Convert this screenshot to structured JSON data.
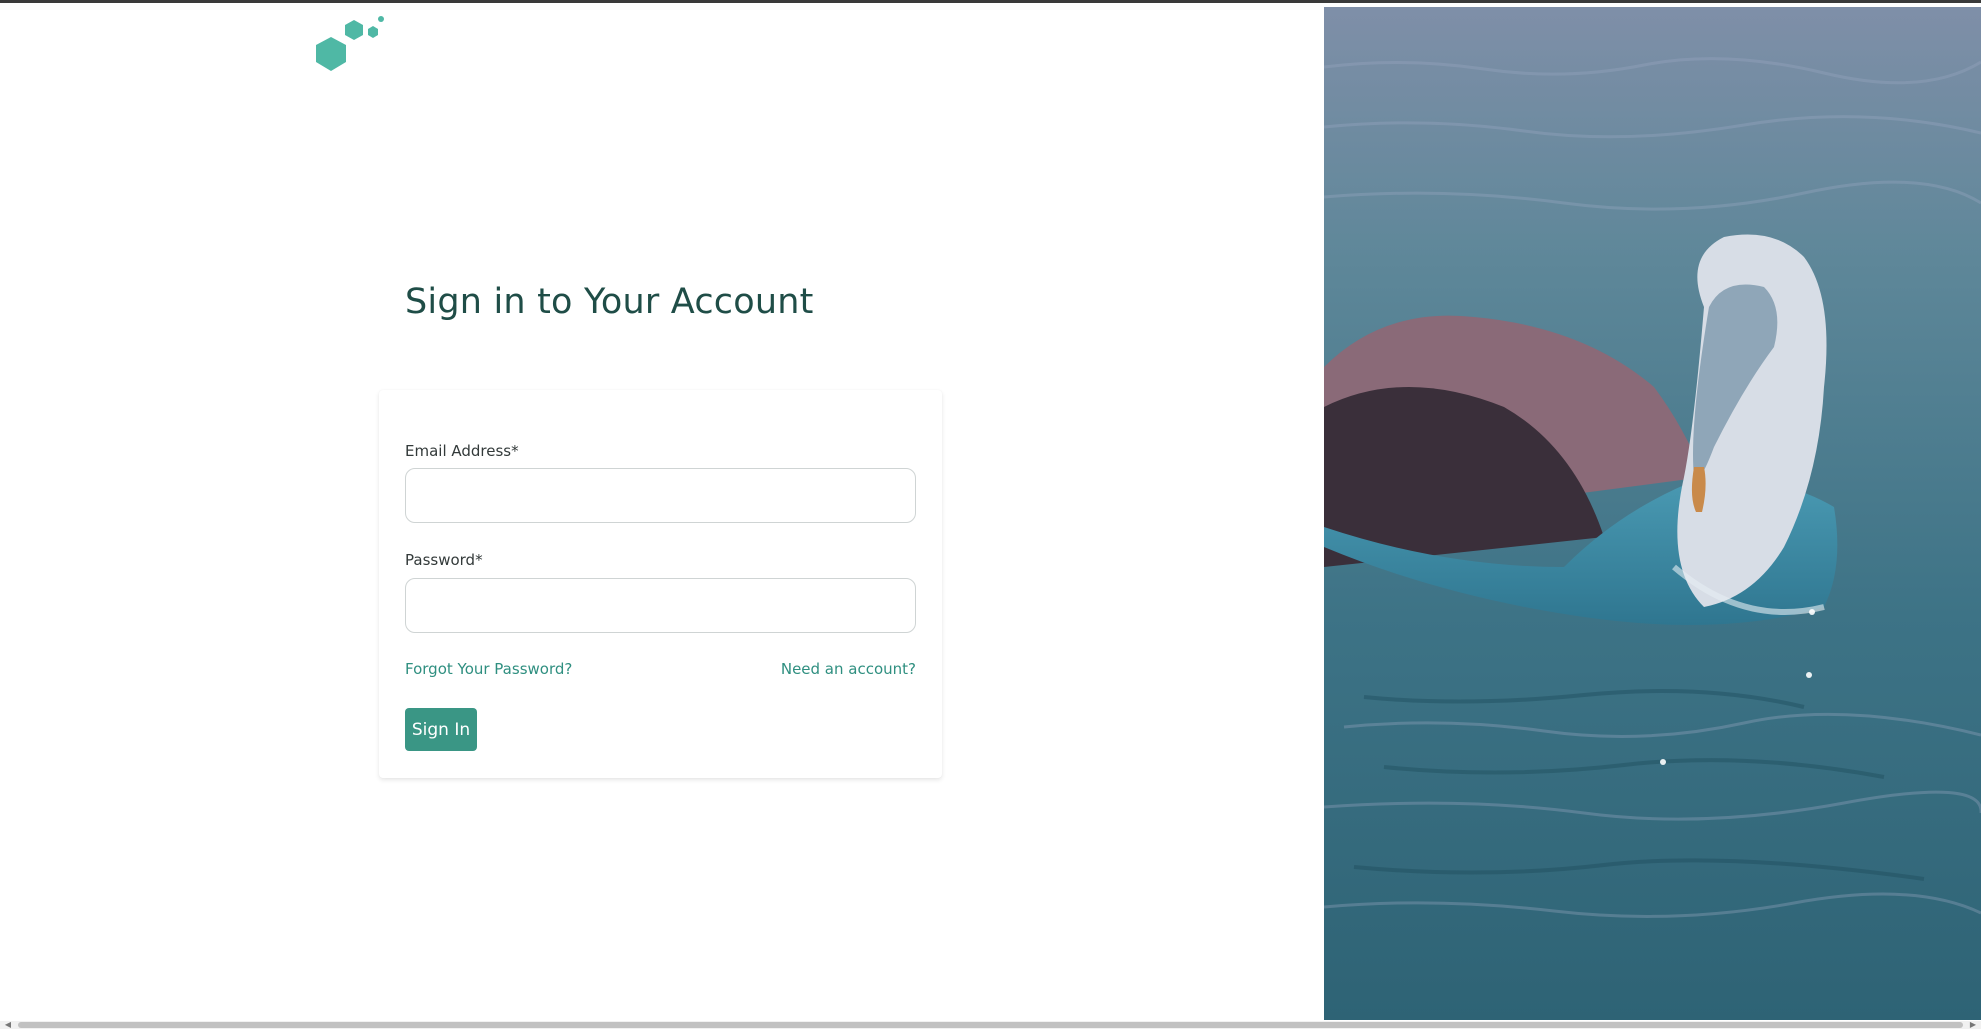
{
  "page": {
    "title": "Sign in to Your Account"
  },
  "form": {
    "email_label": "Email Address*",
    "email_value": "",
    "password_label": "Password*",
    "password_value": "",
    "forgot_link": "Forgot Your Password?",
    "signup_link": "Need an account?",
    "submit_label": "Sign In"
  },
  "colors": {
    "accent": "#3a9685",
    "link": "#2f8f80",
    "title": "#1f4d47",
    "logo": "#4fb8a5"
  },
  "icons": {
    "logo": "hexagon-cluster-logo",
    "scroll_left": "chevron-left-icon",
    "scroll_right": "chevron-right-icon"
  }
}
